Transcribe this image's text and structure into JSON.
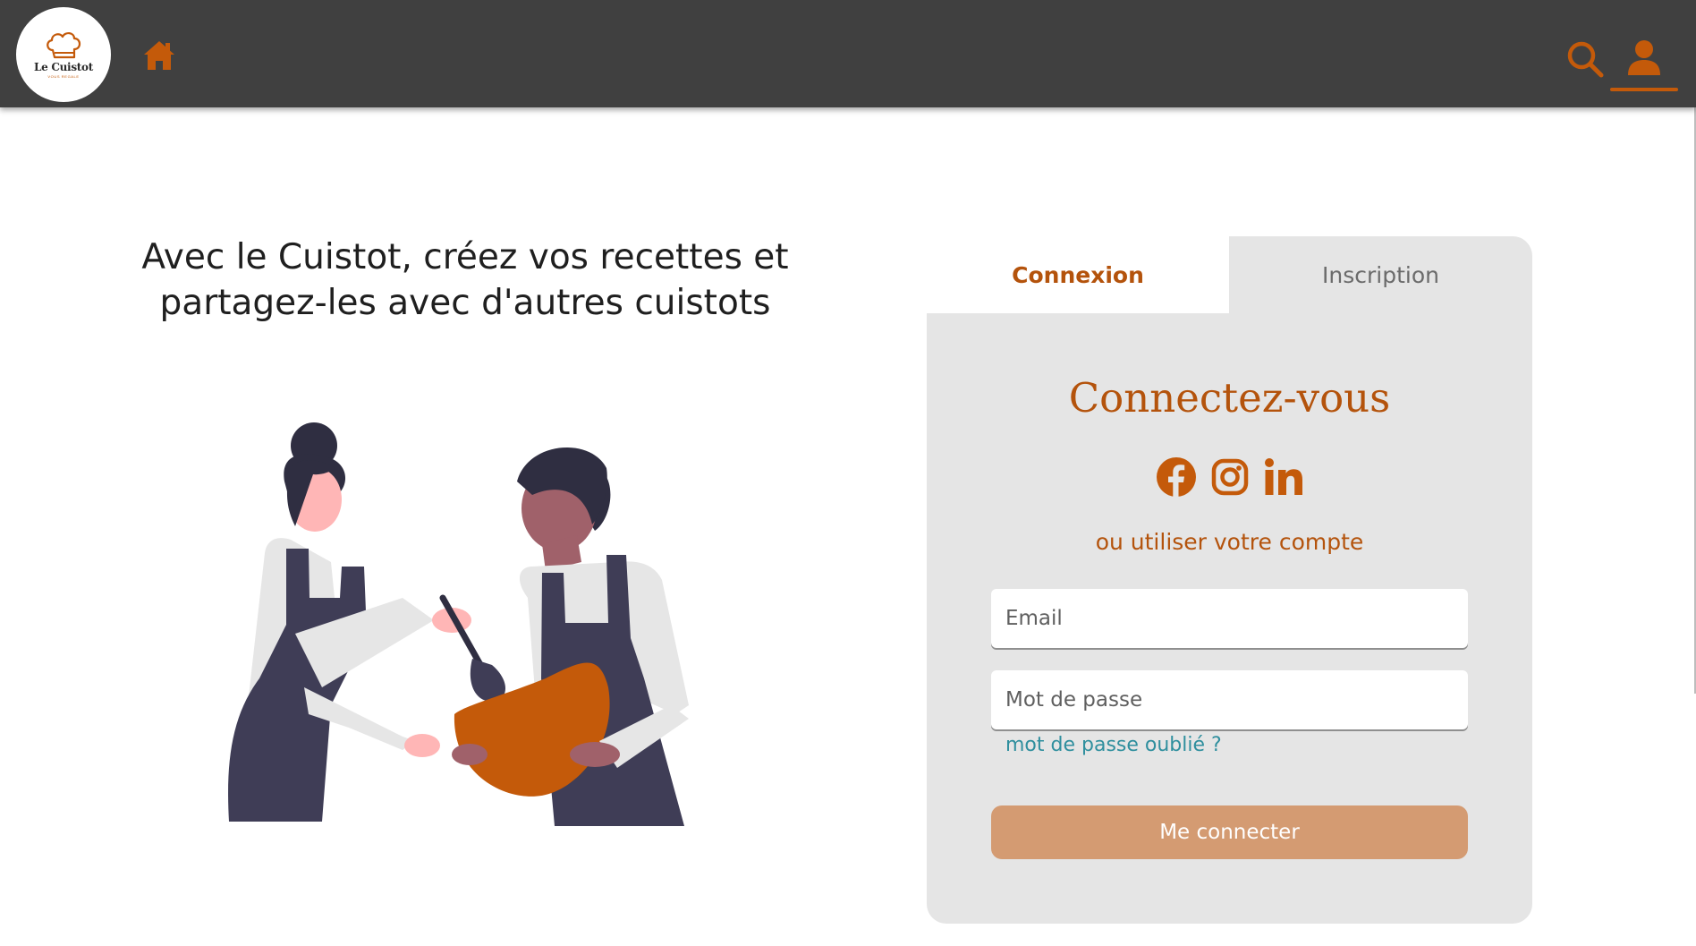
{
  "header": {
    "logo": {
      "name": "Le Cuistot",
      "tagline": "VOUS REGALE"
    },
    "icons": {
      "home": "home-icon",
      "search": "search-icon",
      "user": "user-icon"
    }
  },
  "hero": {
    "title_line1": "Avec le Cuistot, créez vos recettes et",
    "title_line2": "partagez-les avec d'autres cuistots",
    "illustration": "two-cooks-mixing-bowl"
  },
  "auth": {
    "tabs": {
      "login": "Connexion",
      "register": "Inscription",
      "active": "login"
    },
    "title": "Connectez-vous",
    "socials": [
      "facebook-icon",
      "instagram-icon",
      "linkedin-icon"
    ],
    "alt_text": "ou utiliser votre compte",
    "email": {
      "placeholder": "Email",
      "value": ""
    },
    "password": {
      "placeholder": "Mot de passe",
      "value": ""
    },
    "forgot": "mot de passe oublié ?",
    "submit": "Me connecter"
  },
  "colors": {
    "header_bg": "#404040",
    "accent": "#c45a0a",
    "card_bg": "#e5e5e5",
    "link": "#2f8f9e",
    "button": "#d49b72"
  }
}
